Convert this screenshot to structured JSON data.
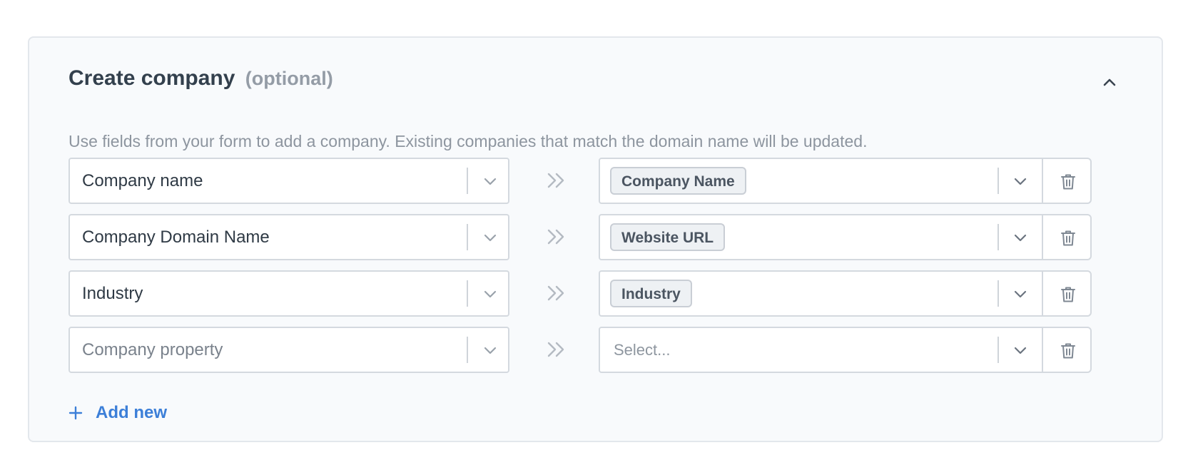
{
  "section": {
    "title": "Create company",
    "optional_label": "(optional)",
    "description": "Use fields from your form to add a company. Existing companies that match the domain name will be updated."
  },
  "rows": [
    {
      "property": "Company name",
      "property_is_placeholder": false,
      "field": "Company Name",
      "field_is_placeholder": false
    },
    {
      "property": "Company Domain Name",
      "property_is_placeholder": false,
      "field": "Website URL",
      "field_is_placeholder": false
    },
    {
      "property": "Industry",
      "property_is_placeholder": false,
      "field": "Industry",
      "field_is_placeholder": false
    },
    {
      "property": "Company property",
      "property_is_placeholder": true,
      "field": "Select...",
      "field_is_placeholder": true
    }
  ],
  "actions": {
    "add_new_label": "Add new"
  },
  "icons": {
    "collapse": "chevron-up-icon",
    "dropdown": "chevron-down-icon",
    "mapping": "double-chevron-right-icon",
    "delete": "trash-icon",
    "add": "plus-icon"
  },
  "colors": {
    "accent": "#3c7fd8",
    "card_background": "#f8fafc",
    "border": "#d4d9df"
  }
}
